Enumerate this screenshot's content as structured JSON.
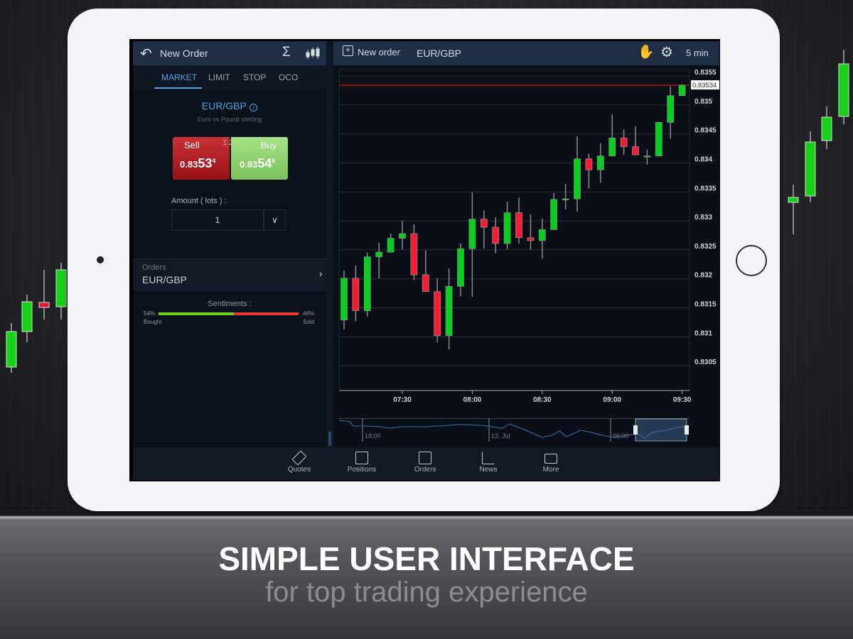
{
  "promo": {
    "headline": "SIMPLE USER INTERFACE",
    "subline": "for top trading experience"
  },
  "left_panel": {
    "title": "New Order",
    "tabs": [
      {
        "label": "MARKET",
        "active": true
      },
      {
        "label": "LIMIT"
      },
      {
        "label": "STOP"
      },
      {
        "label": "OCO"
      }
    ],
    "instrument": "EUR/GBP",
    "instrument_desc": "Euro vs Pound sterling",
    "sell": {
      "label": "Sell",
      "price_prefix": "0.83",
      "price_big": "53",
      "price_sup": "4"
    },
    "buy": {
      "label": "Buy",
      "price_prefix": "0.83",
      "price_big": "54",
      "price_sup": "6"
    },
    "spread": "1.2",
    "amount_label": "Amount ( lots ) :",
    "amount_value": "1",
    "orders_label": "Orders",
    "orders_instrument": "EUR/GBP",
    "sentiments": {
      "label": "Sentiments :",
      "bought_pct": "54%",
      "bought_label": "Bought",
      "sold_pct": "46%",
      "sold_label": "Sold",
      "bought_fraction": 0.54
    }
  },
  "chart_header": {
    "new_order": "New order",
    "symbol": "EUR/GBP",
    "timeframe": "5 min"
  },
  "navigator": {
    "labels": [
      "18:00",
      "13. Jul",
      "06:00"
    ]
  },
  "bottom_nav": [
    {
      "label": "Quotes",
      "icon": "quotes-icon"
    },
    {
      "label": "Positions",
      "icon": "positions-icon"
    },
    {
      "label": "Orders",
      "icon": "orders-icon"
    },
    {
      "label": "News",
      "icon": "news-icon"
    },
    {
      "label": "More",
      "icon": "briefcase-icon"
    }
  ],
  "colors": {
    "up": "#00d21a",
    "down": "#ff1a34",
    "accent": "#4aa3e6",
    "header": "#1d2e45",
    "sell": "#b3181c",
    "buy": "#8fd46a"
  },
  "chart_data": {
    "type": "candlestick",
    "interval": "5 min",
    "y_ticks": [
      "0.8355",
      "0.835",
      "0.8345",
      "0.834",
      "0.8335",
      "0.833",
      "0.8325",
      "0.832",
      "0.8315",
      "0.831",
      "0.8305"
    ],
    "ylim": [
      0.8303,
      0.8358
    ],
    "x_ticks": [
      "07:30",
      "08:00",
      "08:30",
      "09:00",
      "09:30"
    ],
    "current_price": "0.83534",
    "first_candle_time": "07:05",
    "candles_ohlc": [
      [
        0.83129,
        0.83214,
        0.83113,
        0.83201
      ],
      [
        0.83201,
        0.83223,
        0.83127,
        0.83145
      ],
      [
        0.83145,
        0.83245,
        0.83135,
        0.83238
      ],
      [
        0.83238,
        0.83262,
        0.83201,
        0.83246
      ],
      [
        0.83246,
        0.83278,
        0.83246,
        0.8327
      ],
      [
        0.8327,
        0.833,
        0.83251,
        0.83278
      ],
      [
        0.83278,
        0.83294,
        0.83198,
        0.83207
      ],
      [
        0.83207,
        0.83249,
        0.83178,
        0.83178
      ],
      [
        0.83178,
        0.83201,
        0.8309,
        0.83102
      ],
      [
        0.83102,
        0.83218,
        0.83078,
        0.83187
      ],
      [
        0.83187,
        0.83261,
        0.8317,
        0.83252
      ],
      [
        0.83252,
        0.83349,
        0.83169,
        0.83303
      ],
      [
        0.83303,
        0.83318,
        0.83252,
        0.83289
      ],
      [
        0.83289,
        0.83306,
        0.83244,
        0.83261
      ],
      [
        0.83261,
        0.83333,
        0.83251,
        0.83314
      ],
      [
        0.83314,
        0.8334,
        0.83261,
        0.83271
      ],
      [
        0.83271,
        0.83311,
        0.8325,
        0.83266
      ],
      [
        0.83266,
        0.83304,
        0.83235,
        0.83285
      ],
      [
        0.83285,
        0.83348,
        0.83285,
        0.83337
      ],
      [
        0.83338,
        0.83364,
        0.8332,
        0.83338
      ],
      [
        0.83338,
        0.83446,
        0.83316,
        0.83407
      ],
      [
        0.83407,
        0.83416,
        0.83356,
        0.83388
      ],
      [
        0.83388,
        0.83434,
        0.83366,
        0.83412
      ],
      [
        0.83412,
        0.83484,
        0.83412,
        0.83443
      ],
      [
        0.83443,
        0.83458,
        0.83414,
        0.83428
      ],
      [
        0.83428,
        0.83463,
        0.83414,
        0.83414
      ],
      [
        0.83412,
        0.83423,
        0.83397,
        0.83412
      ],
      [
        0.83412,
        0.8347,
        0.83412,
        0.8347
      ],
      [
        0.8347,
        0.83532,
        0.83442,
        0.83516
      ],
      [
        0.83516,
        0.83536,
        0.83516,
        0.83534
      ]
    ]
  }
}
